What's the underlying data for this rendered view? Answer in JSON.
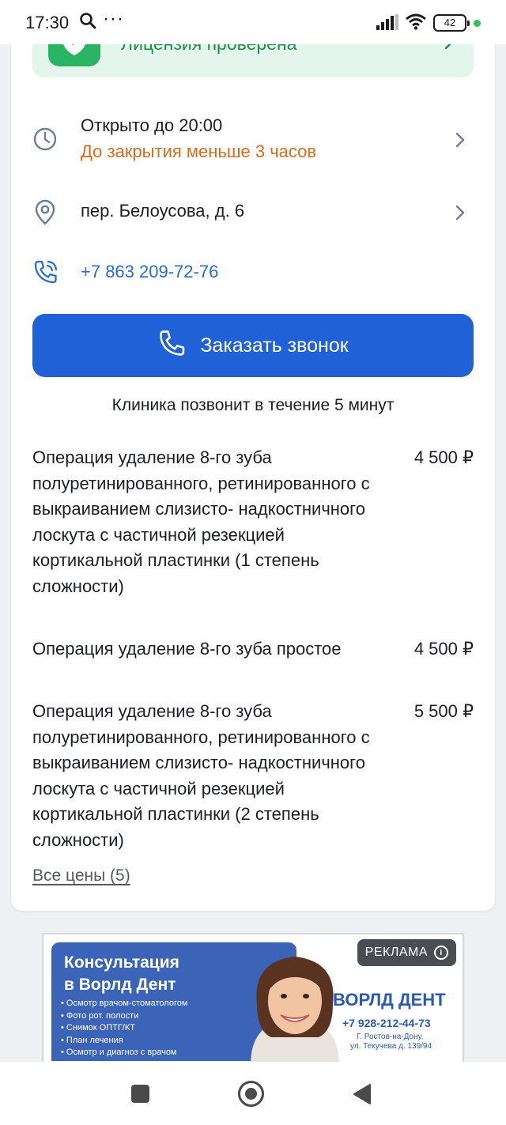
{
  "status_bar": {
    "time": "17:30",
    "battery": "42"
  },
  "license": {
    "label": "Лицензия проверена"
  },
  "hours": {
    "open_until": "Открыто до 20:00",
    "closing_note": "До закрытия меньше 3 часов"
  },
  "address": {
    "text": "пер. Белоусова, д. 6"
  },
  "phone": {
    "number": "+7 863 209-72-76"
  },
  "callback": {
    "button_label": "Заказать звонок",
    "note": "Клиника позвонит в течение 5 минут"
  },
  "prices": [
    {
      "name": "Операция удаление 8-го зуба полуретинированного, ретинированного с выкраиванием слизисто- надкостничного лоскута с частичной резекцией кортикальной пластинки (1 степень сложности)",
      "price": "4 500 ₽"
    },
    {
      "name": "Операция удаление 8-го зуба простое",
      "price": "4 500 ₽"
    },
    {
      "name": "Операция удаление 8-го зуба полуретинированного, ретинированного с выкраиванием слизисто- надкостничного лоскута с частичной резекцией кортикальной пластинки (2 степень сложности)",
      "price": "5 500 ₽"
    }
  ],
  "all_prices_link": "Все цены (5)",
  "ad": {
    "badge": "РЕКЛАМА",
    "title": "Консультация\nв Ворлд Дент",
    "services": [
      "Осмотр врачом-стоматологом",
      "Фото рот. полости",
      "Снимок ОПТГ/КТ",
      "План лечения",
      "Осмотр и диагноз с врачом"
    ],
    "brand": "ВОРЛД ДЕНТ",
    "phone": "+7 928-212-44-73",
    "city": "Г. Ростов-на-Дону,",
    "street": "ул. Текучева д. 139/94"
  },
  "colors": {
    "accent_blue": "#2161d7",
    "license_green": "#28b463",
    "warning_orange": "#d96b1c",
    "link_blue": "#2a6bd6"
  }
}
